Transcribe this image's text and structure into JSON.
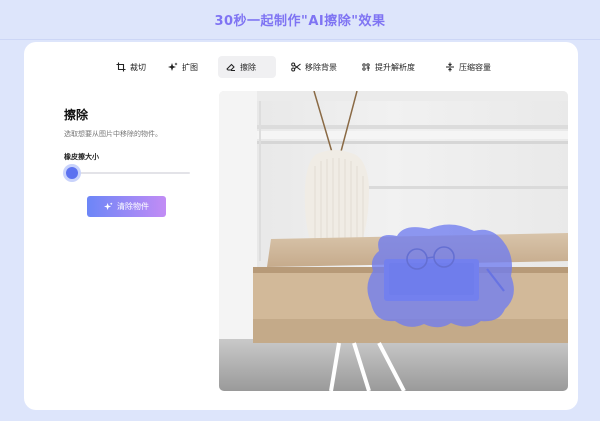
{
  "headline": "30秒一起制作\"AI擦除\"效果",
  "toolbar": {
    "items": [
      {
        "label": "裁切",
        "icon": "crop-icon"
      },
      {
        "label": "扩图",
        "icon": "sparkle-expand-icon"
      },
      {
        "label": "擦除",
        "icon": "eraser-icon",
        "active": true
      },
      {
        "label": "移除背景",
        "icon": "scissors-icon"
      },
      {
        "label": "提升解析度",
        "icon": "enhance-icon"
      },
      {
        "label": "压缩容量",
        "icon": "compress-icon"
      }
    ]
  },
  "panel": {
    "title": "擦除",
    "description": "选取想要从图片中移除的物件。",
    "brush_label": "橡皮擦大小",
    "brush_size": 0.06,
    "clear_button": "清除物件"
  },
  "colors": {
    "accent": "#5c72f0",
    "headline": "#7f74f3",
    "background": "#dde5fb",
    "mask": "#6f7cf0"
  }
}
